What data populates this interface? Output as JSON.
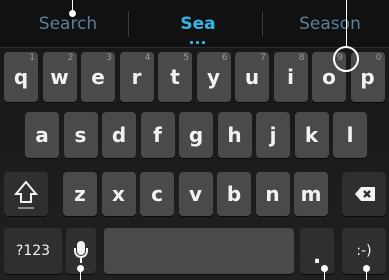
{
  "suggestions": {
    "left": "Search",
    "center": "Sea",
    "right": "Season"
  },
  "row1": [
    {
      "key": "q",
      "hint": "1"
    },
    {
      "key": "w",
      "hint": "2"
    },
    {
      "key": "e",
      "hint": "3"
    },
    {
      "key": "r",
      "hint": "4"
    },
    {
      "key": "t",
      "hint": "5"
    },
    {
      "key": "y",
      "hint": "6"
    },
    {
      "key": "u",
      "hint": "7"
    },
    {
      "key": "i",
      "hint": "8"
    },
    {
      "key": "o",
      "hint": "9"
    },
    {
      "key": "p",
      "hint": "0"
    }
  ],
  "row2": [
    "a",
    "s",
    "d",
    "f",
    "g",
    "h",
    "j",
    "k",
    "l"
  ],
  "row3": [
    "z",
    "x",
    "c",
    "v",
    "b",
    "n",
    "m"
  ],
  "bottom": {
    "symbols": "?123",
    "period": ".",
    "emoji": ":-)"
  },
  "icons": {
    "shift": "shift-arrow-icon",
    "backspace": "backspace-icon",
    "mic": "microphone-icon"
  }
}
